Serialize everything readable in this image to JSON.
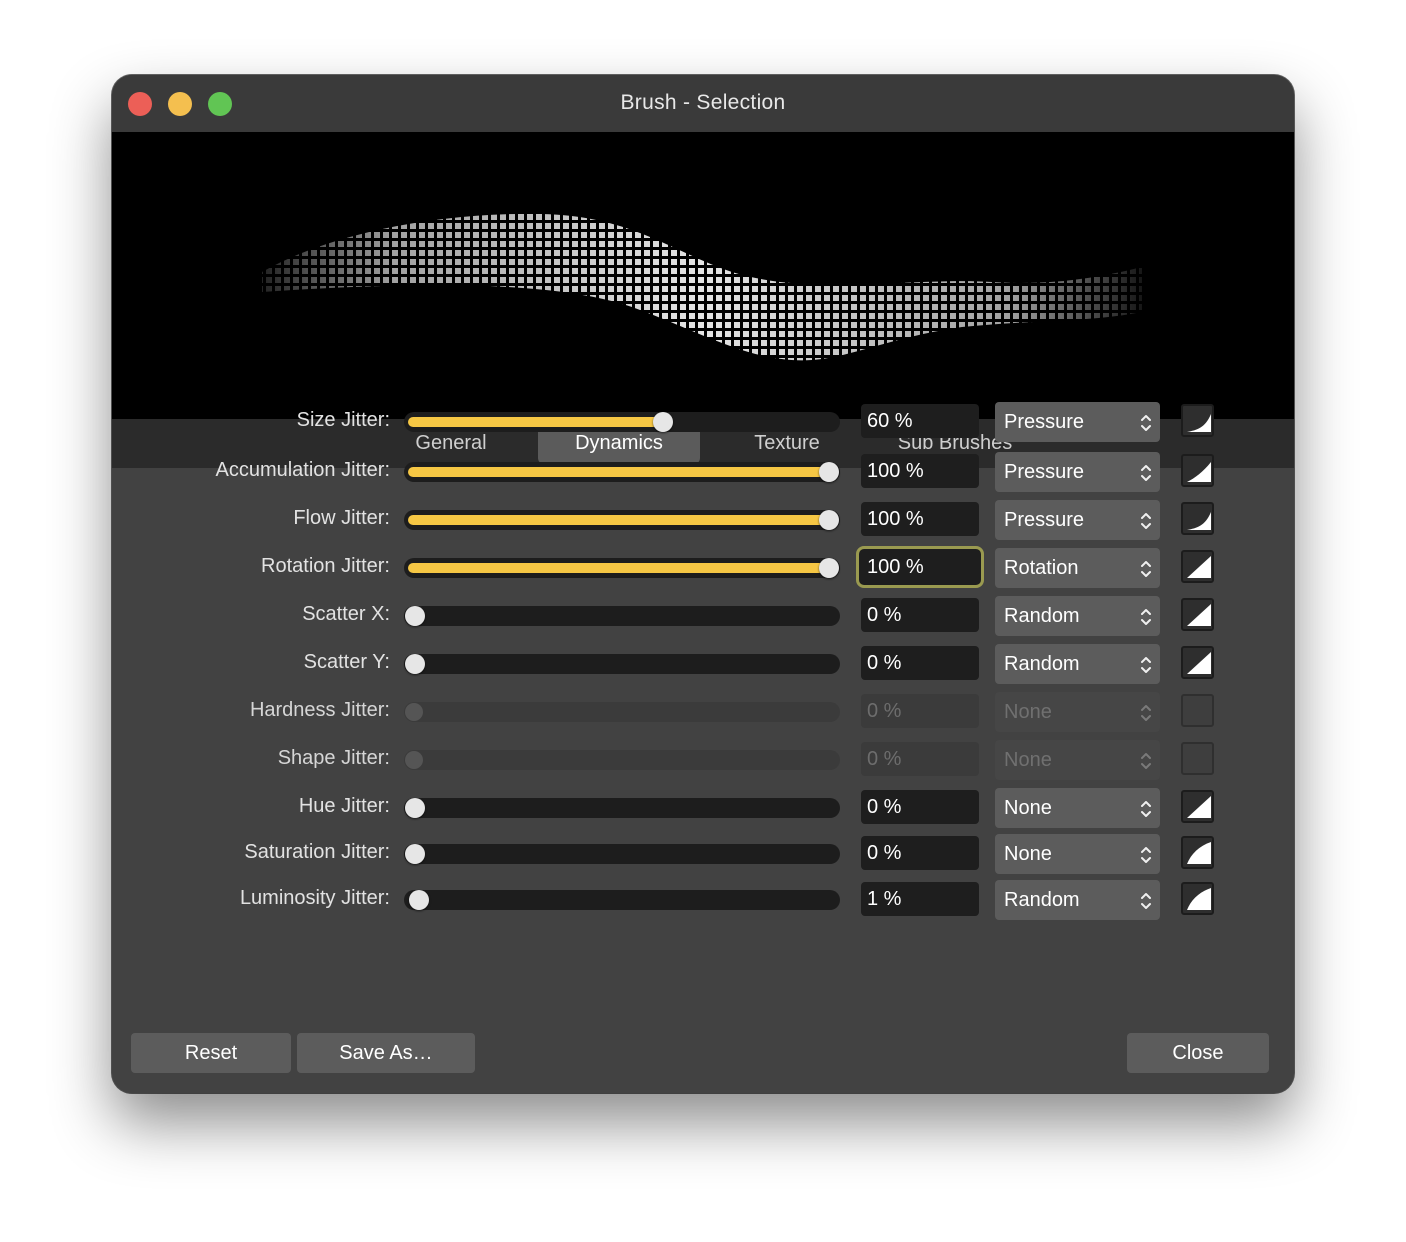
{
  "window": {
    "title": "Brush - Selection"
  },
  "tabs": [
    {
      "label": "General",
      "active": false
    },
    {
      "label": "Dynamics",
      "active": true
    },
    {
      "label": "Texture",
      "active": false
    },
    {
      "label": "Sub Brushes",
      "active": false
    }
  ],
  "rows": [
    {
      "label": "Size Jitter:",
      "value": "60 %",
      "level": 0.6,
      "source": "Pressure",
      "enabled": true,
      "curve": "soft"
    },
    {
      "label": "Accumulation Jitter:",
      "value": "100 %",
      "level": 1.0,
      "source": "Pressure",
      "enabled": true,
      "curve": "medium"
    },
    {
      "label": "Flow Jitter:",
      "value": "100 %",
      "level": 1.0,
      "source": "Pressure",
      "enabled": true,
      "curve": "soft"
    },
    {
      "label": "Rotation Jitter:",
      "value": "100 %",
      "level": 1.0,
      "source": "Rotation",
      "enabled": true,
      "focused": true,
      "curve": "linear"
    },
    {
      "label": "Scatter X:",
      "value": "0 %",
      "level": 0.0,
      "source": "Random",
      "enabled": true,
      "curve": "linear"
    },
    {
      "label": "Scatter Y:",
      "value": "0 %",
      "level": 0.0,
      "source": "Random",
      "enabled": true,
      "curve": "linear"
    },
    {
      "label": "Hardness Jitter:",
      "value": "0 %",
      "level": 0.0,
      "source": "None",
      "enabled": false,
      "curve": "none"
    },
    {
      "label": "Shape Jitter:",
      "value": "0 %",
      "level": 0.0,
      "source": "None",
      "enabled": false,
      "curve": "none"
    },
    {
      "label": "Hue Jitter:",
      "value": "0 %",
      "level": 0.0,
      "source": "None",
      "enabled": true,
      "curve": "linear"
    },
    {
      "label": "Saturation Jitter:",
      "value": "0 %",
      "level": 0.0,
      "source": "None",
      "enabled": true,
      "curve": "convex"
    },
    {
      "label": "Luminosity Jitter:",
      "value": "1 %",
      "level": 0.01,
      "source": "Random",
      "enabled": true,
      "curve": "convex"
    }
  ],
  "buttons": {
    "reset": "Reset",
    "save_as": "Save As…",
    "close": "Close"
  },
  "colors": {
    "accent": "#f6c744",
    "window_bg": "#424242",
    "focus_ring": "#9a9a50"
  }
}
